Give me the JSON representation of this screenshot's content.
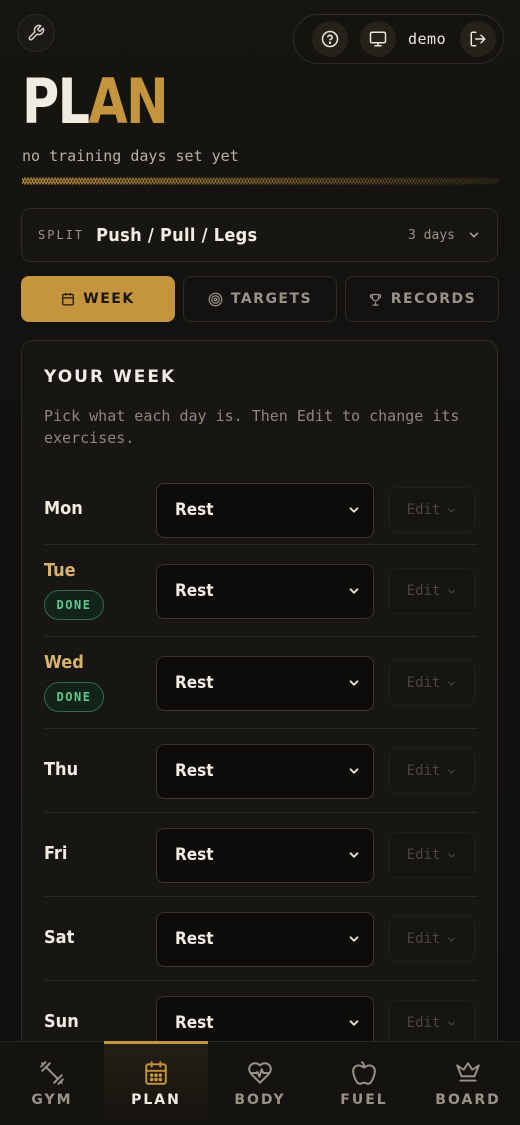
{
  "header": {
    "user": "demo",
    "title_part1": "PL",
    "title_part2": "AN",
    "subtitle": "no training days set yet"
  },
  "split": {
    "label": "SPLIT",
    "name": "Push / Pull / Legs",
    "days": "3 days"
  },
  "tabs": [
    {
      "label": "WEEK",
      "icon": "calendar-icon",
      "active": true
    },
    {
      "label": "TARGETS",
      "icon": "target-icon",
      "active": false
    },
    {
      "label": "RECORDS",
      "icon": "trophy-icon",
      "active": false
    }
  ],
  "week": {
    "title": "YOUR WEEK",
    "hint": "Pick what each day is. Then Edit to change its exercises.",
    "edit_label": "Edit",
    "done_label": "DONE",
    "days": [
      {
        "name": "Mon",
        "value": "Rest",
        "done": false
      },
      {
        "name": "Tue",
        "value": "Rest",
        "done": true
      },
      {
        "name": "Wed",
        "value": "Rest",
        "done": true
      },
      {
        "name": "Thu",
        "value": "Rest",
        "done": false
      },
      {
        "name": "Fri",
        "value": "Rest",
        "done": false
      },
      {
        "name": "Sat",
        "value": "Rest",
        "done": false
      },
      {
        "name": "Sun",
        "value": "Rest",
        "done": false
      }
    ]
  },
  "nav": [
    {
      "label": "GYM",
      "icon": "dumbbell-icon",
      "active": false
    },
    {
      "label": "PLAN",
      "icon": "calendar-icon",
      "active": true
    },
    {
      "label": "BODY",
      "icon": "heart-pulse-icon",
      "active": false
    },
    {
      "label": "FUEL",
      "icon": "apple-icon",
      "active": false
    },
    {
      "label": "BOARD",
      "icon": "crown-icon",
      "active": false
    }
  ],
  "colors": {
    "accent": "#c5953e",
    "background": "#141210",
    "done_green": "#5bc98f"
  }
}
